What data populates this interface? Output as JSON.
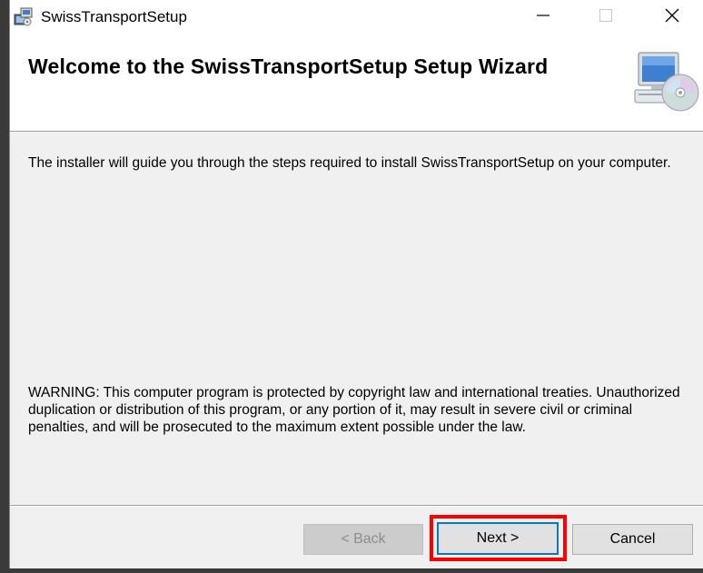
{
  "window": {
    "title": "SwissTransportSetup"
  },
  "header": {
    "title": "Welcome to the SwissTransportSetup Setup Wizard"
  },
  "content": {
    "intro": "The installer will guide you through the steps required to install SwissTransportSetup on your computer.",
    "warning": "WARNING: This computer program is protected by copyright law and international treaties. Unauthorized duplication or distribution of this program, or any portion of it, may result in severe civil or criminal penalties, and will be prosecuted to the maximum extent possible under the law."
  },
  "buttons": {
    "back": "< Back",
    "next": "Next >",
    "cancel": "Cancel"
  },
  "icons": {
    "app": "installer-icon",
    "header": "computer-cd-icon",
    "minimize": "minimize-icon",
    "maximize": "maximize-icon",
    "close": "close-icon"
  },
  "colors": {
    "highlight": "#ff0000",
    "focus_border": "#0078d7"
  }
}
